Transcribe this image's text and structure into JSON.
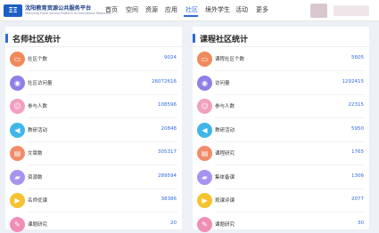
{
  "brand": {
    "title": "沈阳教育资源公共服务平台",
    "subtitle": "Shenyang Public Service Platform for Educational Resources",
    "mark": "ΞΞ"
  },
  "nav": {
    "items": [
      {
        "label": "首页"
      },
      {
        "label": "空间"
      },
      {
        "label": "资源"
      },
      {
        "label": "应用"
      },
      {
        "label": "社区"
      },
      {
        "label": "境外学生"
      },
      {
        "label": "活动"
      },
      {
        "label": "更多"
      }
    ],
    "active_index": 4
  },
  "colors": {
    "accent": "#2d6be0",
    "row_icons": [
      "#f08a5d",
      "#8f7fe6",
      "#f29fc0",
      "#3fb6e8",
      "#f28b6a",
      "#a993f0",
      "#f4c430",
      "#ef8fb5"
    ]
  },
  "left_panel": {
    "title": "名师社区统计",
    "rows": [
      {
        "label": "社区个数",
        "value": "9024",
        "icon": "monitor-icon"
      },
      {
        "label": "社区访问量",
        "value": "26072616",
        "icon": "eye-icon"
      },
      {
        "label": "参与人数",
        "value": "108596",
        "icon": "users-icon"
      },
      {
        "label": "教研活动",
        "value": "20848",
        "icon": "megaphone-icon"
      },
      {
        "label": "文章数",
        "value": "305317",
        "icon": "article-icon"
      },
      {
        "label": "资源数",
        "value": "289594",
        "icon": "folder-icon"
      },
      {
        "label": "名师优课",
        "value": "38386",
        "icon": "video-icon"
      },
      {
        "label": "课题研究",
        "value": "20",
        "icon": "research-icon"
      }
    ]
  },
  "right_panel": {
    "title": "课程社区统计",
    "rows": [
      {
        "label": "课程社区个数",
        "value": "5605",
        "icon": "monitor-icon"
      },
      {
        "label": "访问量",
        "value": "1292415",
        "icon": "eye-icon"
      },
      {
        "label": "参与人数",
        "value": "22315",
        "icon": "users-icon"
      },
      {
        "label": "教研活动",
        "value": "5950",
        "icon": "megaphone-icon"
      },
      {
        "label": "课程研究",
        "value": "1765",
        "icon": "article-icon"
      },
      {
        "label": "集体备课",
        "value": "1306",
        "icon": "folder-icon"
      },
      {
        "label": "观课评课",
        "value": "2077",
        "icon": "video-icon"
      },
      {
        "label": "课题研究",
        "value": "30",
        "icon": "research-icon"
      }
    ]
  }
}
